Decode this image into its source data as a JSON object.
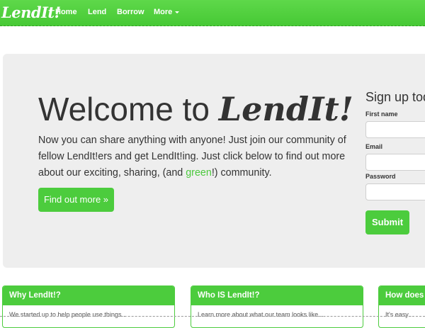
{
  "nav": {
    "brand": "LendIt!",
    "items": [
      {
        "label": "Home"
      },
      {
        "label": "Lend"
      },
      {
        "label": "Borrow"
      },
      {
        "label": "More"
      }
    ]
  },
  "hero": {
    "title_prefix": "Welcome to ",
    "title_brand": "LendIt!",
    "text_before": "Now you can share anything with anyone! Just join our community of fellow LendIt!ers and get LendIt!ing. Just click below to find out more about our exciting, sharing, (and ",
    "text_green": "green",
    "text_after": "!) community.",
    "button_label": "Find out more »"
  },
  "signup": {
    "title": "Sign up today",
    "first_name_label": "First name",
    "email_label": "Email",
    "password_label": "Password",
    "submit_label": "Submit"
  },
  "panels": [
    {
      "title": "Why LendIt!?",
      "body": "We started up to help people use things..."
    },
    {
      "title": "Who IS LendIt!?",
      "body": "Learn more about what our team looks like..."
    },
    {
      "title": "How does it work?",
      "body": "It's easy..."
    }
  ],
  "colors": {
    "brand_green": "#4ccc3d",
    "hero_bg": "#eeeeee"
  }
}
